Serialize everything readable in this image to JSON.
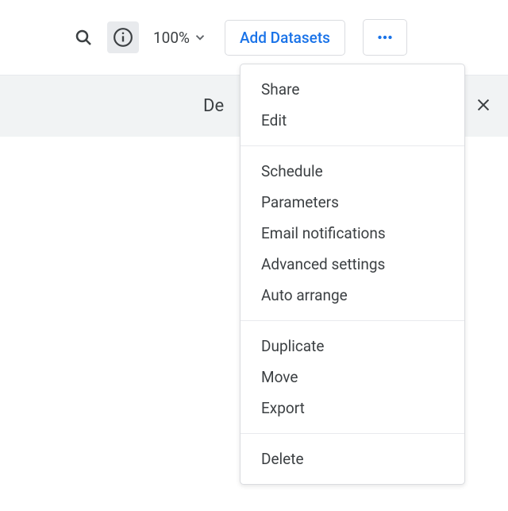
{
  "toolbar": {
    "zoom_level": "100%",
    "add_datasets_label": "Add Datasets"
  },
  "subheader": {
    "title_partial": "De"
  },
  "menu": {
    "groups": [
      {
        "items": [
          {
            "label": "Share"
          },
          {
            "label": "Edit"
          }
        ]
      },
      {
        "items": [
          {
            "label": "Schedule"
          },
          {
            "label": "Parameters"
          },
          {
            "label": "Email notifications"
          },
          {
            "label": "Advanced settings"
          },
          {
            "label": "Auto arrange"
          }
        ]
      },
      {
        "items": [
          {
            "label": "Duplicate"
          },
          {
            "label": "Move"
          },
          {
            "label": "Export"
          }
        ]
      },
      {
        "items": [
          {
            "label": "Delete"
          }
        ]
      }
    ]
  }
}
